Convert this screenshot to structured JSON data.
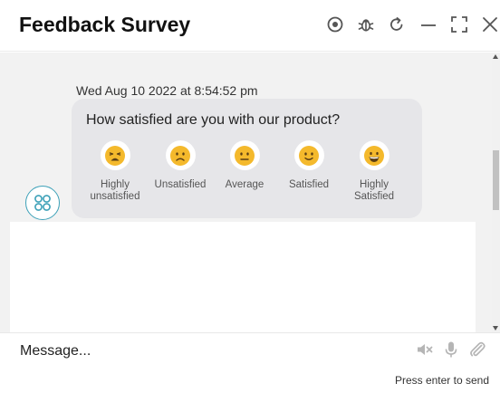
{
  "header": {
    "title": "Feedback Survey",
    "icons": [
      "record-icon",
      "bug-icon",
      "refresh-icon",
      "minimize-icon",
      "expand-icon",
      "close-icon"
    ]
  },
  "chat": {
    "timestamp": "Wed Aug 10 2022 at 8:54:52 pm",
    "question": "How satisfied are you with our product?",
    "options": [
      {
        "label": "Highly\nunsatisfied",
        "icon": "tired-face-icon"
      },
      {
        "label": "Unsatisfied",
        "icon": "frowning-face-icon"
      },
      {
        "label": "Average",
        "icon": "neutral-face-icon"
      },
      {
        "label": "Satisfied",
        "icon": "slightly-smiling-face-icon"
      },
      {
        "label": "Highly\nSatisfied",
        "icon": "grinning-face-icon"
      }
    ],
    "avatar_icon": "bot-avatar-icon"
  },
  "composer": {
    "placeholder": "Message...",
    "hint": "Press enter to send",
    "icons": [
      "mute-icon",
      "microphone-icon",
      "paperclip-icon"
    ]
  },
  "colors": {
    "accent": "#3da1b8",
    "emoji": "#f4b92c",
    "bubble": "#e6e6e9",
    "chat_bg": "#f2f2f2"
  }
}
